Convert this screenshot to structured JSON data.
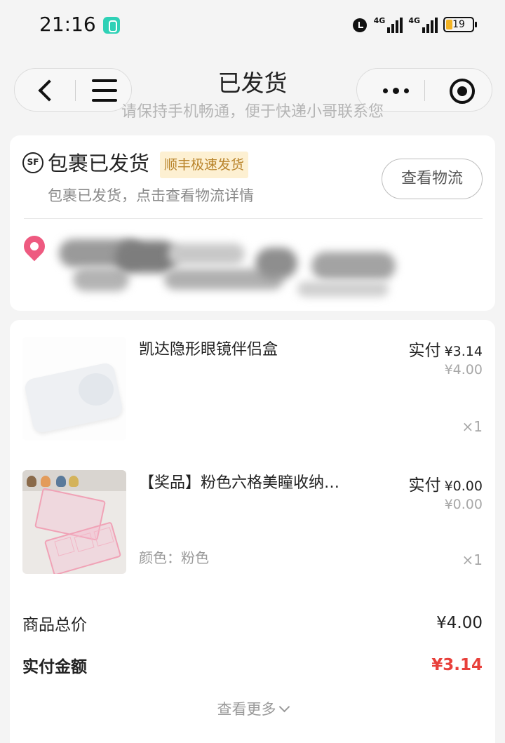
{
  "status_bar": {
    "time": "21:16",
    "network_1": "4G",
    "network_2": "4G",
    "battery_level": "19",
    "icons": [
      "app-icon",
      "alarm-icon",
      "signal-icon",
      "battery-icon"
    ]
  },
  "nav": {
    "title": "已发货",
    "subtitle": "请保持手机畅通，便于快递小哥联系您"
  },
  "shipping": {
    "carrier_logo": "SF",
    "title": "包裹已发货",
    "badge": "顺丰极速发货",
    "description": "包裹已发货，点击查看物流详情",
    "logistics_button": "查看物流"
  },
  "items": [
    {
      "name": "凯达隐形眼镜伴侣盒",
      "pay_label": "实付",
      "pay_amount": "¥3.14",
      "original_price": "¥4.00",
      "quantity": "×1",
      "spec": ""
    },
    {
      "name": "【奖品】粉色六格美瞳收纳…",
      "pay_label": "实付",
      "pay_amount": "¥0.00",
      "original_price": "¥0.00",
      "quantity": "×1",
      "spec": "颜色：粉色"
    }
  ],
  "summary": {
    "total_label": "商品总价",
    "total_value": "¥4.00",
    "paid_label": "实付金额",
    "paid_value": "¥3.14",
    "see_more": "查看更多"
  },
  "colors": {
    "accent_red": "#e8403b",
    "badge_bg": "#fdf0d2",
    "badge_text": "#b9842b",
    "pin": "#ee5a80"
  }
}
